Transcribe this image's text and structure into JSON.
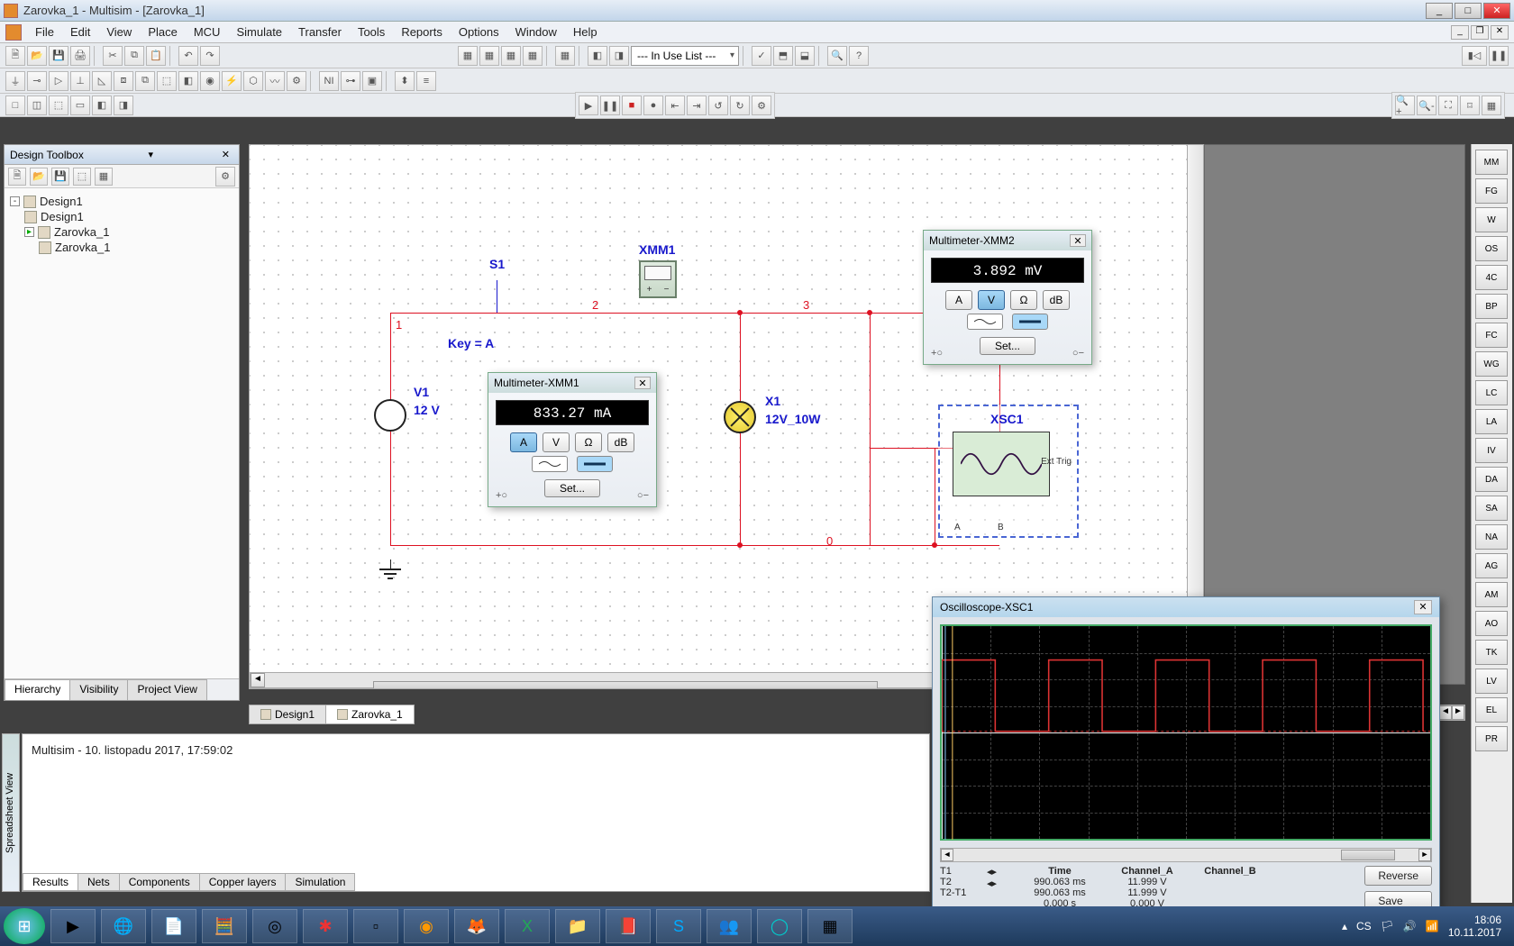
{
  "title": "Zarovka_1 - Multisim - [Zarovka_1]",
  "menu": [
    "File",
    "Edit",
    "View",
    "Place",
    "MCU",
    "Simulate",
    "Transfer",
    "Tools",
    "Reports",
    "Options",
    "Window",
    "Help"
  ],
  "combo_in_use": "--- In Use List ---",
  "toolbox": {
    "title": "Design Toolbox",
    "tree": {
      "root": "Design1",
      "child1": "Design1",
      "child2": "Zarovka_1",
      "child3": "Zarovka_1"
    },
    "tabs": [
      "Hierarchy",
      "Visibility",
      "Project View"
    ]
  },
  "schematic": {
    "S1": "S1",
    "Key": "Key = A",
    "V1": "V1",
    "V1val": "12 V",
    "XMM1": "XMM1",
    "X1": "X1",
    "X1val": "12V_10W",
    "XSC1": "XSC1",
    "XSC1_ExtTrig": "Ext Trig",
    "XSC1_A": "A",
    "XSC1_B": "B",
    "nets": {
      "n0": "0",
      "n1": "1",
      "n2": "2",
      "n3": "3"
    }
  },
  "mm1": {
    "title": "Multimeter-XMM1",
    "reading": "833.27 mA",
    "btns": [
      "A",
      "V",
      "Ω",
      "dB"
    ],
    "set": "Set..."
  },
  "mm2": {
    "title": "Multimeter-XMM2",
    "reading": "3.892 mV",
    "btns": [
      "A",
      "V",
      "Ω",
      "dB"
    ],
    "set": "Set..."
  },
  "doc_tabs": [
    "Design1",
    "Zarovka_1"
  ],
  "spreadsheet": {
    "title": "Spreadsheet View",
    "log": "Multisim  -  10. listopadu 2017, 17:59:02",
    "tabs": [
      "Results",
      "Nets",
      "Components",
      "Copper layers",
      "Simulation"
    ]
  },
  "osc": {
    "title": "Oscilloscope-XSC1",
    "cols": [
      "Time",
      "Channel_A",
      "Channel_B"
    ],
    "rows": {
      "T1": {
        "lbl": "T1",
        "time": "990.063 ms",
        "cha": "11.999 V"
      },
      "T2": {
        "lbl": "T2",
        "time": "990.063 ms",
        "cha": "11.999 V"
      },
      "dT": {
        "lbl": "T2-T1",
        "time": "0.000 s",
        "cha": "0.000 V"
      }
    },
    "reverse": "Reverse",
    "save": "Save"
  },
  "tray": {
    "lang": "CS",
    "time": "18:06",
    "date": "10.11.2017"
  }
}
